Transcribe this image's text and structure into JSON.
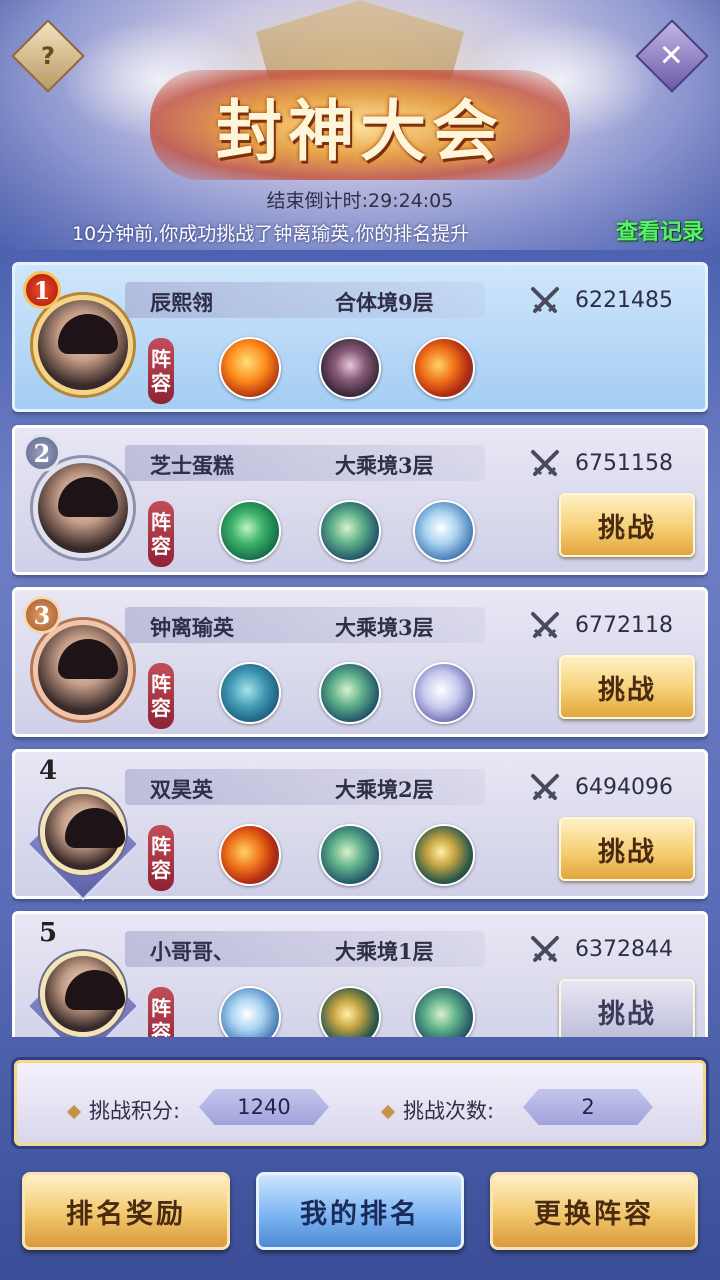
{
  "header": {
    "title": "封神大会",
    "countdown_label": "结束倒计时:29:24:05",
    "notice": "10分钟前,你成功挑战了钟离瑜英,你的排名提升",
    "record_link": "查看记录",
    "help_icon": "?",
    "close_icon": "✕"
  },
  "lineup_label": "阵容",
  "players": [
    {
      "rank": "1",
      "name": "辰熙翎",
      "realm": "合体境9层",
      "power": "6221485",
      "is_me": true,
      "pets": [
        "phoenix",
        "darkdragon",
        "firedragon"
      ],
      "action": ""
    },
    {
      "rank": "2",
      "name": "芝士蛋糕",
      "realm": "大乘境3层",
      "power": "6751158",
      "is_me": false,
      "pets": [
        "greendragon",
        "tealdragon",
        "icedragon"
      ],
      "action": "挑战"
    },
    {
      "rank": "3",
      "name": "钟离瑜英",
      "realm": "大乘境3层",
      "power": "6772118",
      "is_me": false,
      "pets": [
        "whale",
        "tealdragon",
        "wolf"
      ],
      "action": "挑战"
    },
    {
      "rank": "4",
      "name": "双昊英",
      "realm": "大乘境2层",
      "power": "6494096",
      "is_me": false,
      "pets": [
        "firedragon",
        "tealdragon",
        "yellowbeast"
      ],
      "action": "挑战"
    },
    {
      "rank": "5",
      "name": "小哥哥、",
      "realm": "大乘境1层",
      "power": "6372844",
      "is_me": false,
      "pets": [
        "icedragon",
        "yellowbeast",
        "tealdragon"
      ],
      "action": "挑战"
    }
  ],
  "stats": {
    "points_label": "挑战积分:",
    "points_value": "1240",
    "count_label": "挑战次数:",
    "count_value": "2"
  },
  "buttons": {
    "rewards": "排名奖励",
    "my_rank": "我的排名",
    "change_lineup": "更换阵容"
  }
}
